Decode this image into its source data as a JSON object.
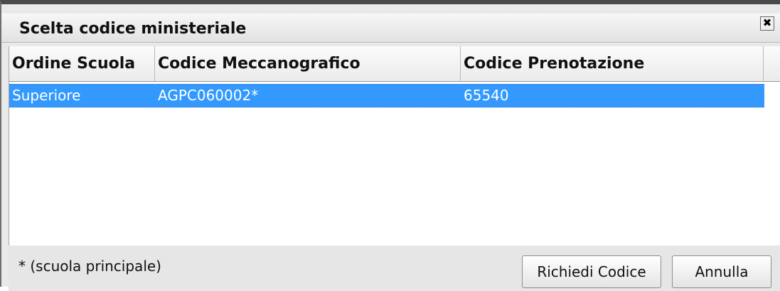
{
  "dialog": {
    "title": "Scelta codice ministeriale",
    "close_glyph": "✖"
  },
  "grid": {
    "columns": [
      "Ordine Scuola",
      "Codice Meccanografico",
      "Codice Prenotazione"
    ],
    "rows": [
      [
        "Superiore",
        "AGPC060002*",
        "65540"
      ]
    ],
    "selected_row_color": "#3399ff"
  },
  "footer": {
    "note": "* (scuola principale)",
    "request_button": "Richiedi Codice",
    "cancel_button": "Annulla"
  }
}
